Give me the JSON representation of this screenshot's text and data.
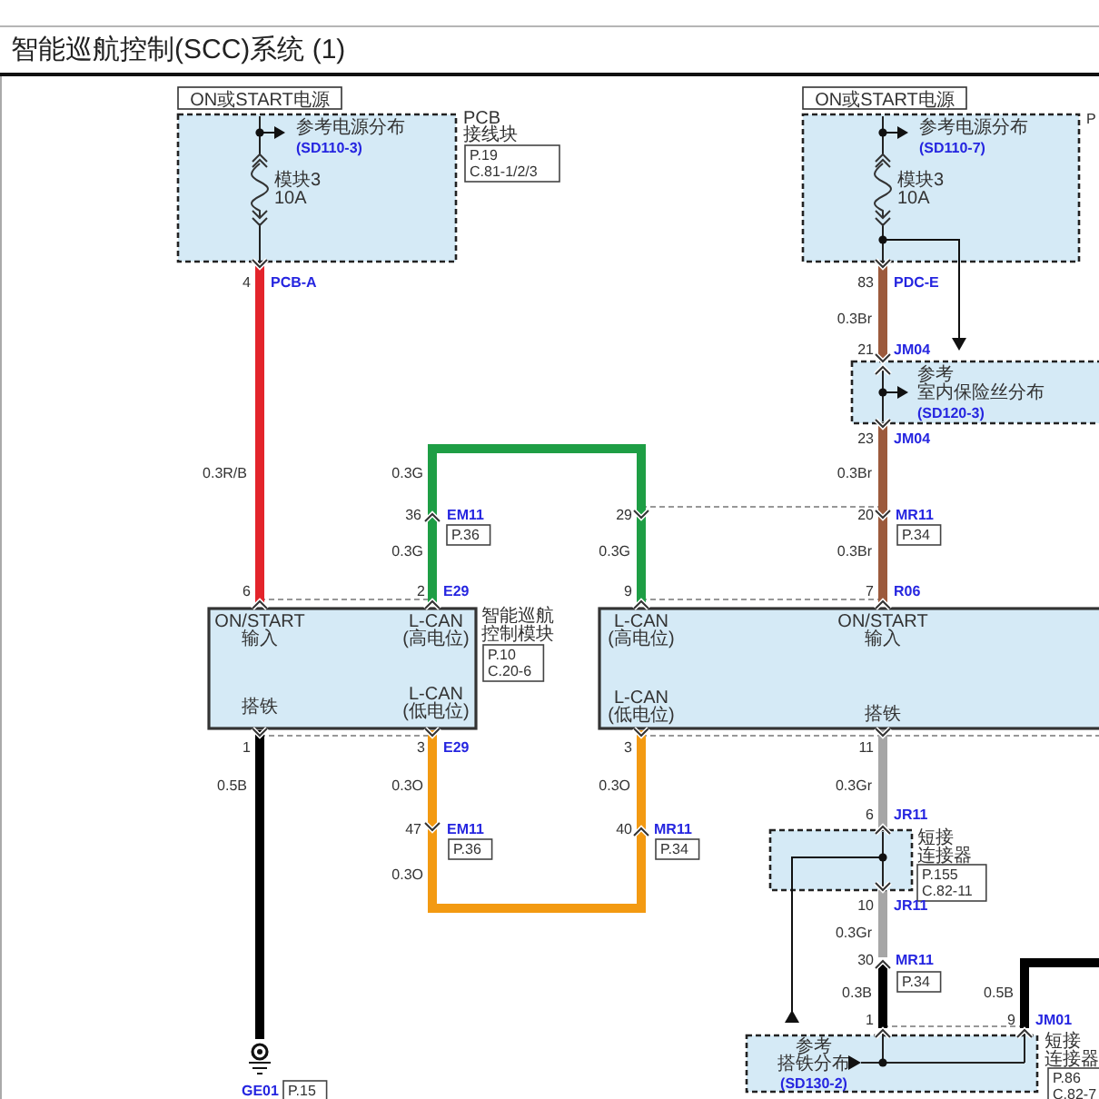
{
  "title": "智能巡航控制(SCC)系统 (1)",
  "power_supplies": [
    {
      "text": "ON或START电源"
    },
    {
      "text": "ON或START电源"
    }
  ],
  "fuse_boxes": [
    {
      "ref_label": "参考电源分布",
      "ref_code": "(SD110-3)",
      "fuse": [
        "模块3",
        "10A"
      ],
      "block_name": [
        "PCB",
        "接线块"
      ],
      "page_ref": [
        "P.19",
        "C.81-1/2/3"
      ]
    },
    {
      "ref_label": "参考电源分布",
      "ref_code": "(SD110-7)",
      "fuse": [
        "模块3",
        "10A"
      ],
      "block_name": [
        "P"
      ]
    }
  ],
  "references": [
    {
      "lines": [
        "参考",
        "室内保险丝分布"
      ],
      "code": "(SD120-3)"
    },
    {
      "lines": [
        "参考",
        "搭铁分布"
      ],
      "code": "(SD130-2)"
    }
  ],
  "wires": [
    {
      "color": "#e3242b",
      "labels": [
        "0.3R/B"
      ]
    },
    {
      "color": "#9c5a3c",
      "labels": [
        "0.3Br"
      ]
    },
    {
      "color": "#1e9e45",
      "labels": [
        "0.3G",
        "0.3G",
        "0.3G"
      ]
    },
    {
      "color": "#9c5a3c",
      "labels": [
        "0.3Br",
        "0.3Br"
      ]
    },
    {
      "color": "#000000",
      "labels": [
        "0.5B"
      ]
    },
    {
      "color": "#f39a12",
      "labels": [
        "0.3O",
        "0.3O",
        "0.3O"
      ]
    },
    {
      "color": "#a6a6a6",
      "labels": [
        "0.3Gr",
        "0.3Gr"
      ]
    },
    {
      "color": "#000000",
      "labels": [
        "0.3B"
      ]
    },
    {
      "color": "#000000",
      "labels": [
        "0.5B"
      ]
    }
  ],
  "connector_pins": [
    {
      "pin": "4",
      "code": "PCB-A"
    },
    {
      "pin": "83",
      "code": "PDC-E"
    },
    {
      "pin": "21",
      "code": "JM04"
    },
    {
      "pin": "23",
      "code": "JM04"
    },
    {
      "pin": "36",
      "code": "EM11",
      "page_ref": [
        "P.36"
      ]
    },
    {
      "pin": "29"
    },
    {
      "pin": "20",
      "code": "MR11",
      "page_ref": [
        "P.34"
      ]
    },
    {
      "pin": "6"
    },
    {
      "pin": "2",
      "code": "E29"
    },
    {
      "pin": "9"
    },
    {
      "pin": "7",
      "code": "R06"
    },
    {
      "pin": "1"
    },
    {
      "pin": "3",
      "code": "E29"
    },
    {
      "pin": "3"
    },
    {
      "pin": "11"
    },
    {
      "pin": "6",
      "code": "JR11"
    },
    {
      "pin": "47",
      "code": "EM11",
      "page_ref": [
        "P.36"
      ]
    },
    {
      "pin": "40",
      "code": "MR11",
      "page_ref": [
        "P.34"
      ]
    },
    {
      "pin": "10",
      "code": "JR11"
    },
    {
      "pin": "30",
      "code": "MR11",
      "page_ref": [
        "P.34"
      ]
    },
    {
      "pin": "1"
    },
    {
      "pin": "9",
      "code": "JM01"
    }
  ],
  "modules": [
    {
      "name": [
        "智能巡航",
        "控制模块"
      ],
      "page_ref": [
        "P.10",
        "C.20-6"
      ],
      "pins": [
        {
          "lines": [
            "ON/START",
            "输入"
          ]
        },
        {
          "lines": [
            "L-CAN",
            "(高电位)"
          ]
        },
        {
          "lines": [
            "搭铁"
          ]
        },
        {
          "lines": [
            "L-CAN",
            "(低电位)"
          ]
        }
      ]
    },
    {
      "pins": [
        {
          "lines": [
            "L-CAN",
            "(高电位)"
          ]
        },
        {
          "lines": [
            "ON/START",
            "输入"
          ]
        },
        {
          "lines": [
            "L-CAN",
            "(低电位)"
          ]
        },
        {
          "lines": [
            "搭铁"
          ]
        }
      ]
    }
  ],
  "splices": [
    {
      "name": [
        "短接",
        "连接器"
      ],
      "page_ref": [
        "P.155",
        "C.82-11"
      ]
    },
    {
      "name": [
        "短接",
        "连接器"
      ],
      "page_ref": [
        "P.86",
        "C.82-7"
      ]
    }
  ],
  "ground": {
    "code": "GE01",
    "page_ref": [
      "P.15"
    ]
  }
}
